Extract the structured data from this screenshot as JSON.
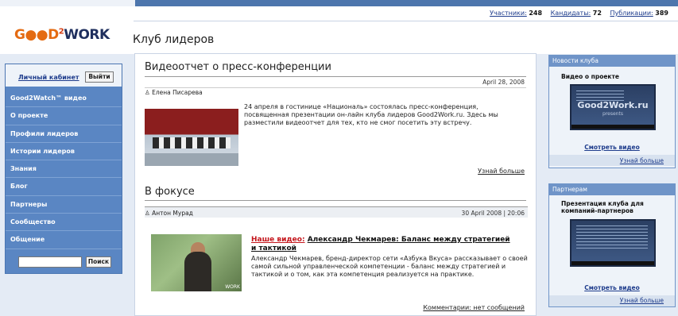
{
  "header": {
    "stats": [
      {
        "label": "Участники:",
        "value": "248"
      },
      {
        "label": "Кандидаты:",
        "value": "72"
      },
      {
        "label": "Публикации:",
        "value": "389"
      }
    ],
    "logo": {
      "part1": "G",
      "part2": "●●D",
      "sup": "2",
      "part3": "WORK"
    },
    "page_title": "Клуб лидеров"
  },
  "sidebar": {
    "cabinet_link": "Личный кабинет",
    "logout_label": "Выйти",
    "items": [
      {
        "label": "Good2Watch™ видео"
      },
      {
        "label": "О проекте"
      },
      {
        "label": "Профили лидеров"
      },
      {
        "label": "Истории лидеров"
      },
      {
        "label": "Знания"
      },
      {
        "label": "Блог"
      },
      {
        "label": "Партнеры"
      },
      {
        "label": "Сообщество"
      },
      {
        "label": "Общение"
      }
    ],
    "search_value": "",
    "search_button": "Поиск"
  },
  "main": {
    "article1": {
      "title": "Видеоотчет о пресс-конференции",
      "date": "April 28, 2008",
      "author": "Елена Писарева",
      "text": "24 апреля в гостинице «Националь» состоялась пресс-конференция, посвященная презентации он-лайн клуба лидеров Good2Work.ru. Здесь мы разместили видеоотчет для тех, кто не смог посетить эту встречу.",
      "more": "Узнай больше"
    },
    "focus": {
      "heading": "В фокусе",
      "author": "Антон Мурад",
      "date": "30 April 2008 | 20:06",
      "title_prefix": "Наше видео:",
      "title_link": "Александр Чекмарев: Баланс между стратегией и тактикой",
      "text": "Александр Чекмарев, бренд-директор сети «Азбука Вкуса» рассказывает о своей самой сильной управленческой компетенции - баланс между стратегией и тактикой и о том, как эта компетенция реализуется на практике.",
      "comments": "Комментарии: нет сообщений"
    }
  },
  "right": {
    "news": {
      "header": "Новости клуба",
      "title": "Видео о проекте",
      "video_title": "Good2Work.ru",
      "video_sub": "presents",
      "watch": "Смотреть видео",
      "more": "Узнай больше"
    },
    "partners": {
      "header": "Партнерам",
      "title": "Презентация клуба для компаний-партнеров",
      "watch": "Смотреть видео",
      "more": "Узнай больше"
    }
  }
}
